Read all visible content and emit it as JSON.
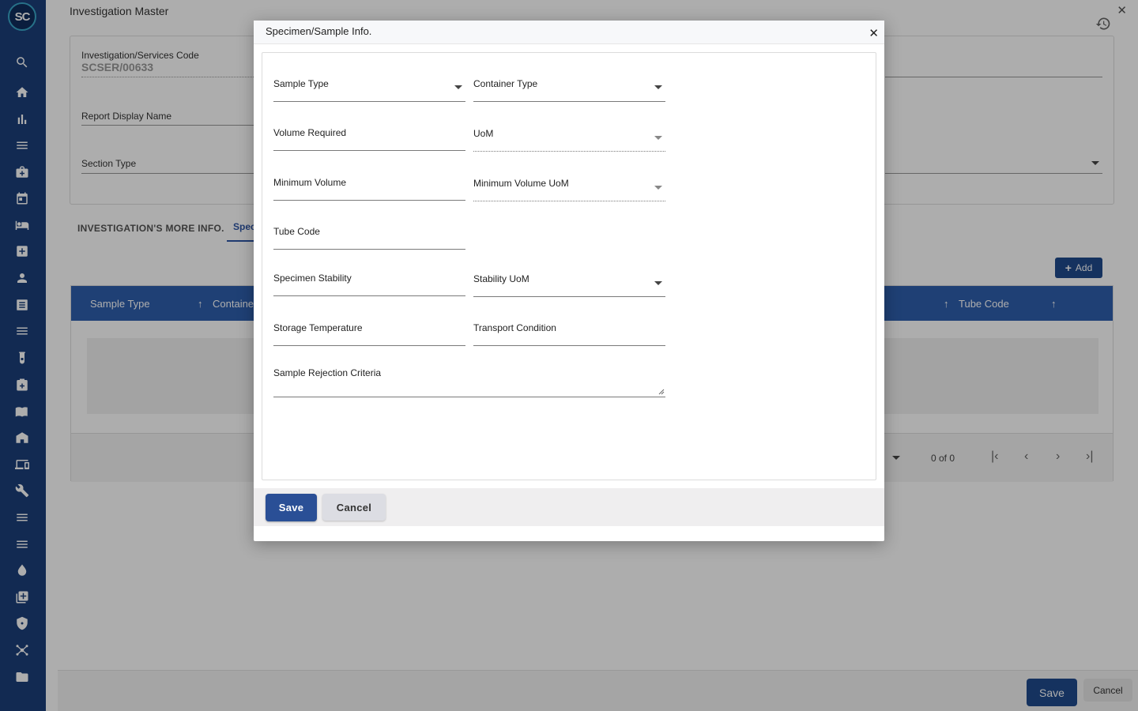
{
  "app": {
    "logo_text": "SC"
  },
  "rail": {
    "icons": [
      "search-icon",
      "home-icon",
      "bar-chart-icon",
      "menu-icon",
      "briefcase-medical-icon",
      "calendar-icon",
      "bed-icon",
      "plus-square-icon",
      "user-icon",
      "newspaper-icon",
      "list-icon",
      "flask-icon",
      "medicine-box-icon",
      "book-icon",
      "store-icon",
      "devices-icon",
      "wrench-icon",
      "menu-icon",
      "menu-icon",
      "drop-icon",
      "add-box-icon",
      "shield-icon",
      "hub-icon",
      "folder-icon"
    ]
  },
  "main": {
    "title": "Investigation Master",
    "code_label": "Investigation/Services Code",
    "code_value": "SCSER/00633",
    "report_display_label": "Report Display Name",
    "section_type_label": "Section Type",
    "more_info_label": "INVESTIGATION'S MORE INFO.",
    "tab_spec_label": "Spec",
    "add_label": "Add",
    "grid_headers": {
      "sample_type": "Sample Type",
      "container": "Containe",
      "tube_code": "Tube Code"
    },
    "pager_text": "0 of 0",
    "save_label": "Save",
    "cancel_label": "Cancel"
  },
  "modal": {
    "title": "Specimen/Sample Info.",
    "fields": {
      "sample_type": "Sample Type",
      "container_type": "Container Type",
      "volume_required": "Volume Required",
      "uom": "UoM",
      "minimum_volume": "Minimum Volume",
      "minimum_volume_uom": "Minimum Volume UoM",
      "tube_code": "Tube Code",
      "specimen_stability": "Specimen Stability",
      "stability_uom": "Stability UoM",
      "storage_temperature": "Storage Temperature",
      "transport_condition": "Transport Condition",
      "sample_rejection_criteria": "Sample Rejection Criteria"
    },
    "save_label": "Save",
    "cancel_label": "Cancel"
  },
  "colors": {
    "primary": "#2a4f96",
    "rail": "#1b3f7a",
    "grid_header": "#2f5fad"
  }
}
